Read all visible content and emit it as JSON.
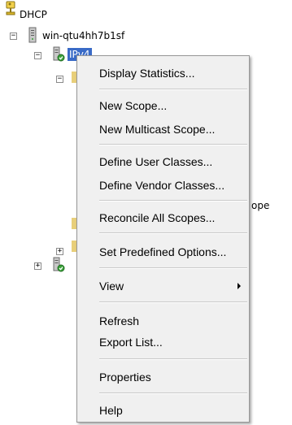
{
  "tree": {
    "root_label": "DHCP",
    "server_label": "win-qtu4hh7b1sf",
    "ipv4_label": "IPv4",
    "partial_scope_text": "ope"
  },
  "menu": {
    "items": [
      {
        "label": "Display Statistics..."
      },
      {
        "label": "New Scope..."
      },
      {
        "label": "New Multicast Scope..."
      },
      {
        "label": "Define User Classes..."
      },
      {
        "label": "Define Vendor Classes..."
      },
      {
        "label": "Reconcile All Scopes..."
      },
      {
        "label": "Set Predefined Options..."
      },
      {
        "label": "View"
      },
      {
        "label": "Refresh"
      },
      {
        "label": "Export List..."
      },
      {
        "label": "Properties"
      },
      {
        "label": "Help"
      }
    ]
  }
}
